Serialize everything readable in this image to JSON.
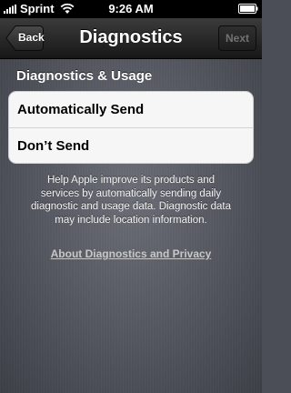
{
  "status_bar": {
    "carrier": "Sprint",
    "time": "9:26 AM",
    "icons": [
      "signal-icon",
      "wifi-icon",
      "battery-icon"
    ]
  },
  "nav": {
    "title": "Diagnostics",
    "back_label": "Back",
    "next_label": "Next",
    "next_enabled": false
  },
  "section": {
    "header": "Diagnostics & Usage",
    "options": [
      {
        "label": "Automatically Send"
      },
      {
        "label": "Don’t Send"
      }
    ]
  },
  "help": {
    "text": "Help Apple improve its products and services by automatically sending daily diagnostic and usage data. Diagnostic data may include location information.",
    "link": "About Diagnostics and Privacy"
  },
  "colors": {
    "background": "#5a5d65",
    "nav_bar": "#1f1f1f",
    "group_background": "#f6f6f6",
    "link": "#c7c7c7"
  }
}
